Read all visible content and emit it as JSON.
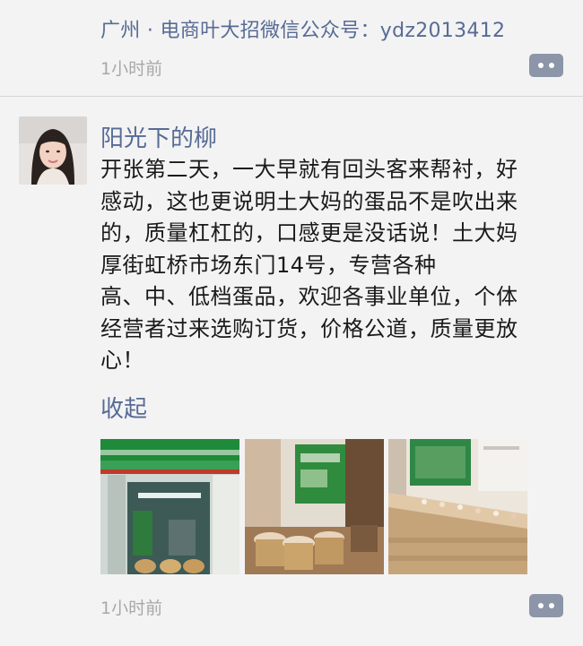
{
  "header_post": {
    "location": "广州 · 电商叶大招微信公众号：ydz2013412",
    "time": "1小时前"
  },
  "post": {
    "author": "阳光下的柳",
    "content": "开张第二天，一大早就有回头客来帮衬，好\n感动，这也更说明土大妈的蛋品不是吹出来\n的，质量杠杠的，口感更是没话说！土大妈\n厚街虹桥市场东门14号，专营各种\n高、中、低档蛋品，欢迎各事业单位，个体\n经营者过来选购订货，价格公道，质量更放\n心！",
    "collapse_label": "收起",
    "time": "1小时前",
    "photos": [
      {
        "icon": "storefront-photo"
      },
      {
        "icon": "egg-baskets-photo"
      },
      {
        "icon": "egg-shelves-photo"
      }
    ]
  },
  "colors": {
    "link": "#576b95",
    "time": "#a8a8a8",
    "comment_button": "#8c96a8",
    "background": "#f3f3f3"
  }
}
